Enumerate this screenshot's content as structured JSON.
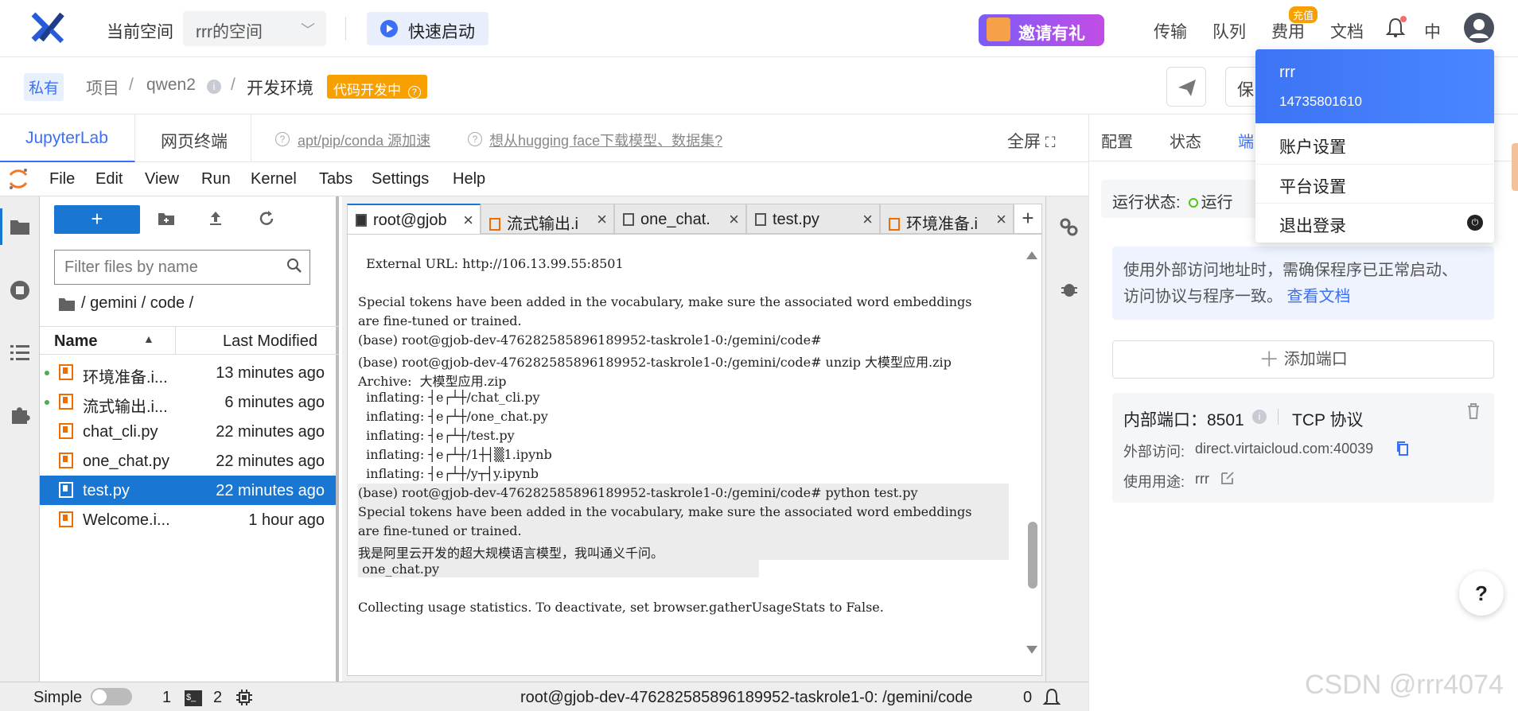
{
  "topbar": {
    "current_space_label": "当前空间",
    "space_select_value": "rrr的空间",
    "quick_start": "快速启动",
    "invite": "邀请有礼",
    "nav": [
      "传输",
      "队列",
      "费用",
      "文档"
    ],
    "fee_badge": "充值",
    "lang": "中"
  },
  "breadcrumb": {
    "private_tag": "私有",
    "items": [
      "项目",
      "qwen2",
      "开发环境"
    ],
    "separator": "/",
    "status_tag": "代码开发中",
    "save_label": "保"
  },
  "tabs": {
    "jupyterlab": "JupyterLab",
    "terminal": "网页终端",
    "help_links": [
      "apt/pip/conda 源加速",
      "想从hugging face下载模型、数据集?"
    ],
    "fullscreen": "全屏"
  },
  "menu": [
    "File",
    "Edit",
    "View",
    "Run",
    "Kernel",
    "Tabs",
    "Settings",
    "Help"
  ],
  "filebrowser": {
    "filter_placeholder": "Filter files by name",
    "path": "/ gemini / code /",
    "col_name": "Name",
    "col_modified": "Last Modified",
    "files": [
      {
        "name": "环境准备.i...",
        "modified": "13 minutes ago",
        "running": true,
        "selected": false
      },
      {
        "name": "流式输出.i...",
        "modified": "6 minutes ago",
        "running": true,
        "selected": false
      },
      {
        "name": "chat_cli.py",
        "modified": "22 minutes ago",
        "running": false,
        "selected": false
      },
      {
        "name": "one_chat.py",
        "modified": "22 minutes ago",
        "running": false,
        "selected": false
      },
      {
        "name": "test.py",
        "modified": "22 minutes ago",
        "running": false,
        "selected": true
      },
      {
        "name": "Welcome.i...",
        "modified": "1 hour ago",
        "running": false,
        "selected": false
      }
    ]
  },
  "editor_tabs": [
    "root@gjob",
    "流式输出.i",
    "one_chat.",
    "test.py",
    "环境准备.i"
  ],
  "terminal_lines": [
    "  External URL: http://106.13.99.55:8501",
    "",
    "Special tokens have been added in the vocabulary, make sure the associated word embeddings",
    "are fine-tuned or trained.",
    "(base) root@gjob-dev-476282585896189952-taskrole1-0:/gemini/code#",
    "(base) root@gjob-dev-476282585896189952-taskrole1-0:/gemini/code# unzip 大模型应用.zip",
    "Archive:  大模型应用.zip",
    "  inflating: ┤e┌┴┼/chat_cli.py",
    "  inflating: ┤e┌┴┼/one_chat.py",
    "  inflating: ┤e┌┴┼/test.py",
    "  inflating: ┤e┌┴┼/1┼┤▒1.ipynb",
    "  inflating: ┤e┌┴┼/y┬┤y.ipynb",
    "(base) root@gjob-dev-476282585896189952-taskrole1-0:/gemini/code# python test.py",
    "Special tokens have been added in the vocabulary, make sure the associated word embeddings",
    "are fine-tuned or trained.",
    "我是阿里云开发的超大规模语言模型，我叫通义千问。",
    " one_chat.py",
    "",
    "Collecting usage statistics. To deactivate, set browser.gatherUsageStats to False."
  ],
  "statusbar": {
    "mode": "Simple",
    "count1": "1",
    "count2": "2",
    "terminal_path": "root@gjob-dev-476282585896189952-taskrole1-0: /gemini/code",
    "notifications": "0"
  },
  "rightpanel": {
    "tabs": [
      "配置",
      "状态",
      "端"
    ],
    "run_status_label": "运行状态:",
    "run_status_value": "运行",
    "info_text_1": "使用外部访问地址时，需确保程序已正常启动、",
    "info_text_2": "访问协议与程序一致。",
    "info_link": "查看文档",
    "add_port": "添加端口",
    "port": {
      "internal_label": "内部端口：8501",
      "protocol": "TCP 协议",
      "external_label": "外部访问:",
      "external_value": "direct.virtaicloud.com:40039",
      "usage_label": "使用用途:",
      "usage_value": "rrr"
    }
  },
  "user_menu": {
    "name": "rrr",
    "phone": "14735801610",
    "items": [
      "账户设置",
      "平台设置",
      "退出登录"
    ]
  },
  "help_button": "?",
  "watermark": "CSDN @rrr4074"
}
